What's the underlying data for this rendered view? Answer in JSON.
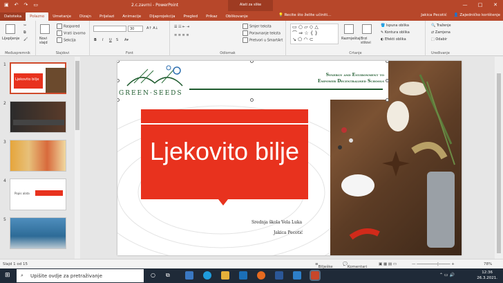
{
  "window": {
    "doc_title": "2.c.zavrni - PowerPoint",
    "context_tab": "Alati za slike",
    "user": "Jakica Pecotić",
    "controls": [
      "—",
      "□",
      "✕"
    ]
  },
  "tabs": [
    "Datoteka",
    "Polazno",
    "Umetanje",
    "Dizajn",
    "Prijelazi",
    "Animacije",
    "Dijaprojekcija",
    "Pregled",
    "Prikaz",
    "Oblikovanje"
  ],
  "search_hint": "Recite što želite učiniti...",
  "share": "Zajedničko korištenje",
  "ribbon": {
    "paste": "Lijepljenje",
    "new_slide": "Novi slajd",
    "layout": "Raspored",
    "reset": "Vrati izvorno",
    "section": "Sekcija",
    "font_size": "30",
    "text_dir": "Smjer teksta",
    "align_text": "Poravnanje teksta",
    "smartart": "Pretvori u SmartArt",
    "arrange": "Razmještaj",
    "quick_styles": "Brzi stilovi",
    "fill": "Ispuna oblika",
    "outline": "Kontura oblika",
    "effects": "Efekti oblika",
    "find": "Traženje",
    "replace": "Zamjena",
    "select": "Odabir",
    "groups": [
      "Međuspremnik",
      "Slajdovi",
      "Font",
      "Odlomak",
      "Crtanje",
      "Uređivanje"
    ]
  },
  "thumbs": [
    {
      "num": "1"
    },
    {
      "num": "2"
    },
    {
      "num": "3"
    },
    {
      "num": "4"
    },
    {
      "num": "5"
    }
  ],
  "thumb_texts": {
    "t1": "Ljekovito bilje",
    "t4": "Popis alata"
  },
  "slide": {
    "logo": "GREEN·SEEDS",
    "tagline1": "Synergy and Environment to",
    "tagline2": "Empower Decentralised Schools",
    "title": "Ljekovito bilje",
    "school": "Srednja škola Vela Luka",
    "author": "Jakica Pecotić"
  },
  "status": {
    "slide_info": "Slajd 1 od 15",
    "notes": "Bilješke",
    "comments": "Komentari",
    "zoom": "78%"
  },
  "taskbar": {
    "search": "Upišite ovdje za pretraživanje",
    "time": "12:36",
    "date": "26.3.2021."
  },
  "colors": {
    "accent": "#b7472a",
    "title_red": "#e8321e",
    "logo_green": "#1d5a2d"
  }
}
